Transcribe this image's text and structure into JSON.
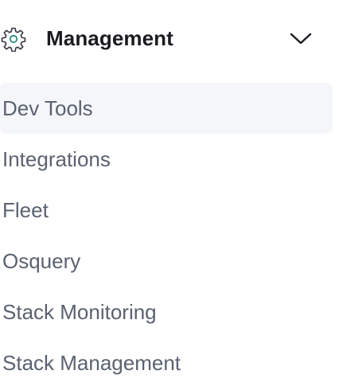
{
  "header": {
    "title": "Management",
    "icon": "gear-icon",
    "expand_icon": "chevron-down-icon"
  },
  "items": [
    {
      "label": "Dev Tools",
      "active": true
    },
    {
      "label": "Integrations",
      "active": false
    },
    {
      "label": "Fleet",
      "active": false
    },
    {
      "label": "Osquery",
      "active": false
    },
    {
      "label": "Stack Monitoring",
      "active": false
    },
    {
      "label": "Stack Management",
      "active": false
    }
  ],
  "colors": {
    "title": "#1a1c21",
    "item_text": "#5a6271",
    "active_background": "#f4f6f9",
    "icon_stroke": "#343741",
    "icon_accent": "#2c8a7e"
  }
}
